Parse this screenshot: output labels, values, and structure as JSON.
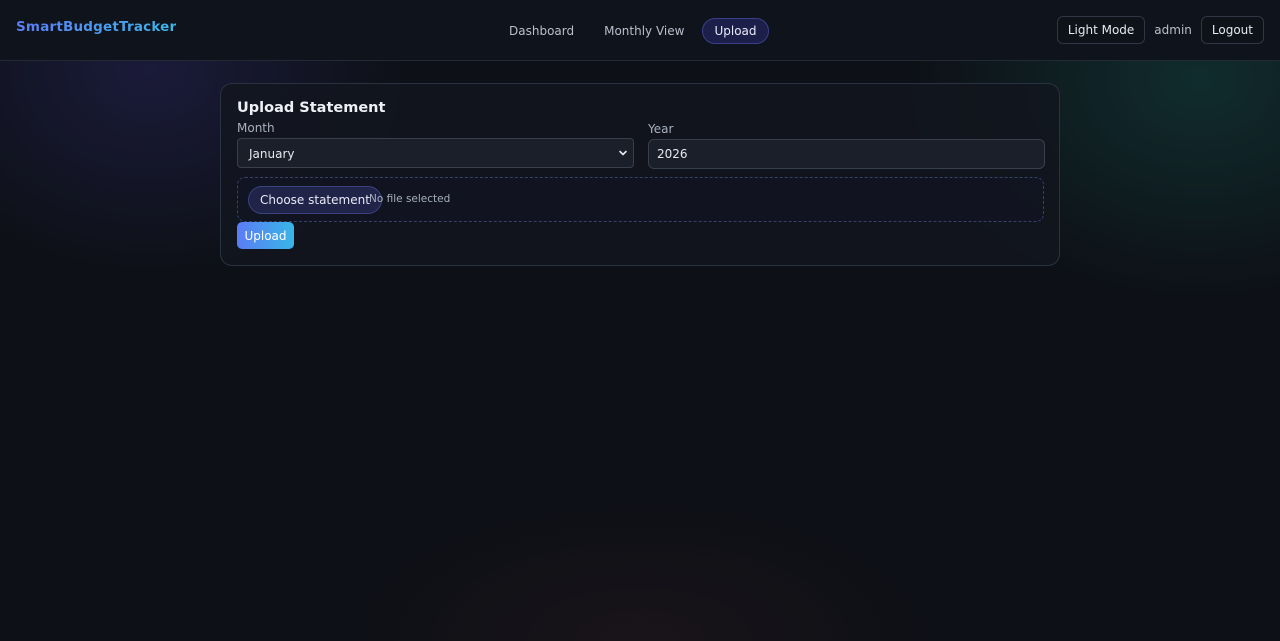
{
  "navbar": {
    "brand": "SmartBudgetTracker",
    "links": [
      {
        "label": "Dashboard",
        "active": false
      },
      {
        "label": "Monthly View",
        "active": false
      },
      {
        "label": "Upload",
        "active": true
      }
    ],
    "theme_toggle_label": "Light Mode",
    "username": "admin",
    "logout_label": "Logout"
  },
  "upload_form": {
    "title": "Upload Statement",
    "month_label": "Month",
    "month_selected": "January",
    "year_label": "Year",
    "year_value": "2026",
    "choose_file_label": "Choose statement",
    "file_status": "No file selected",
    "submit_label": "Upload"
  },
  "colors": {
    "background": "#0d1016",
    "brand_gradient_start": "#5b7cf5",
    "brand_gradient_end": "#38b6e6",
    "active_nav": "#1c1f4a"
  },
  "icons": {
    "month_select_arrow": "chevron-down-icon"
  }
}
